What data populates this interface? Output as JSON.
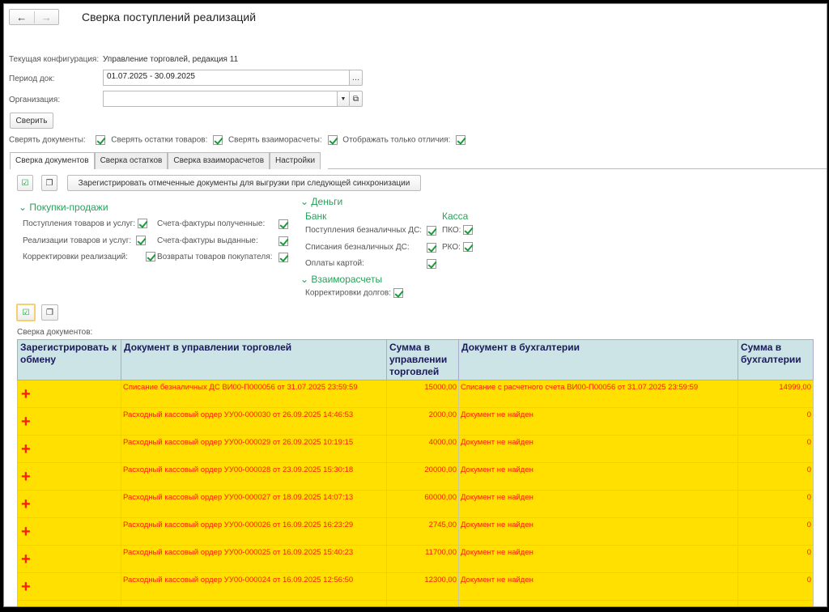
{
  "title": "Сверка поступлений реализаций",
  "config_label": "Текущая конфигурация:",
  "config_value": "Управление торговлей, редакция 11",
  "period_label": "Период док:",
  "period_value": "01.07.2025 - 30.09.2025",
  "org_label": "Организация:",
  "org_value": "",
  "compare_button": "Сверить",
  "options": [
    {
      "label": "Сверять документы:",
      "checked": true
    },
    {
      "label": "Сверять остатки товаров:",
      "checked": true
    },
    {
      "label": "Сверять взаиморасчеты:",
      "checked": true
    },
    {
      "label": "Отображать только отличия:",
      "checked": true
    }
  ],
  "tabs": [
    "Сверка документов",
    "Сверка остатков",
    "Сверка взаиморасчетов",
    "Настройки"
  ],
  "register_button": "Зарегистрировать отмеченные документы для выгрузки при следующей синхронизации",
  "groups": {
    "sales": {
      "title": "Покупки-продажи",
      "items": [
        "Поступления товаров и услуг:",
        "Реализации товаров и услуг:",
        "Корректировки реализаций:",
        "Счета-фактуры полученные:",
        "Счета-фактуры выданные:",
        "Возвраты товаров покупателя:"
      ]
    },
    "money": {
      "title": "Деньги",
      "bank": "Банк",
      "cash": "Касса",
      "bank_items": [
        "Поступления безналичных ДС:",
        "Списания безналичных ДС:",
        "Оплаты картой:"
      ],
      "cash_items": [
        "ПКО:",
        "РКО:"
      ]
    },
    "settlements": {
      "title": "Взаиморасчеты",
      "items": [
        "Корректировки долгов:"
      ]
    }
  },
  "table_label": "Сверка документов:",
  "columns": [
    "Зарегистрировать к обмену",
    "Документ в управлении торговлей",
    "Сумма в управлении торговлей",
    "Документ в бухгалтерии",
    "Сумма в бухгалтерии"
  ],
  "rows": [
    {
      "doc": "Списание безналичных ДС ВИ00-П000056 от 31.07.2025 23:59:59",
      "sum": "15000,00",
      "acc_doc": "Списание с расчетного счета ВИ00-П00056 от 31.07.2025 23:59:59",
      "acc_sum": "14999,00"
    },
    {
      "doc": "Расходный кассовый ордер УУ00-000030 от 26.09.2025 14:46:53",
      "sum": "2000,00",
      "acc_doc": "Документ не найден",
      "acc_sum": "0"
    },
    {
      "doc": "Расходный кассовый ордер УУ00-000029 от 26.09.2025 10:19:15",
      "sum": "4000,00",
      "acc_doc": "Документ не найден",
      "acc_sum": "0"
    },
    {
      "doc": "Расходный кассовый ордер УУ00-000028 от 23.09.2025 15:30:18",
      "sum": "20000,00",
      "acc_doc": "Документ не найден",
      "acc_sum": "0"
    },
    {
      "doc": "Расходный кассовый ордер УУ00-000027 от 18.09.2025 14:07:13",
      "sum": "60000,00",
      "acc_doc": "Документ не найден",
      "acc_sum": "0"
    },
    {
      "doc": "Расходный кассовый ордер УУ00-000026 от 16.09.2025 16:23:29",
      "sum": "2745,00",
      "acc_doc": "Документ не найден",
      "acc_sum": "0"
    },
    {
      "doc": "Расходный кассовый ордер УУ00-000025 от 16.09.2025 15:40:23",
      "sum": "11700,00",
      "acc_doc": "Документ не найден",
      "acc_sum": "0"
    },
    {
      "doc": "Расходный кассовый ордер УУ00-000024 от 16.09.2025 12:56:50",
      "sum": "12300,00",
      "acc_doc": "Документ не найден",
      "acc_sum": "0"
    }
  ]
}
